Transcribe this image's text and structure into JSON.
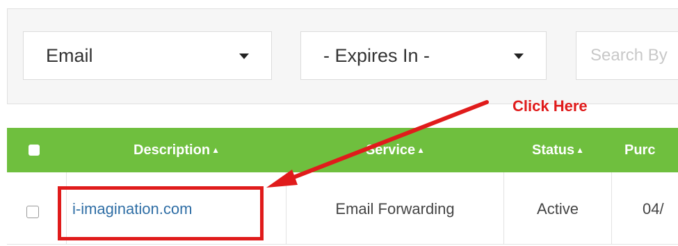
{
  "filters": {
    "type_select": {
      "value": "Email",
      "icon": "caret-down-icon"
    },
    "expires_select": {
      "value": "- Expires In -",
      "icon": "caret-down-icon"
    },
    "search": {
      "placeholder": "Search By"
    }
  },
  "table": {
    "header_color": "#6fbf3e",
    "columns": [
      {
        "label": "Description",
        "sort": "▲"
      },
      {
        "label": "Service",
        "sort": "▲"
      },
      {
        "label": "Status",
        "sort": "▲"
      },
      {
        "label": "Purc"
      }
    ],
    "rows": [
      {
        "description": "i-imagination.com",
        "service": "Email Forwarding",
        "status": "Active",
        "purchase": "04/"
      }
    ]
  },
  "annotation": {
    "label": "Click Here",
    "color": "#e01b1b"
  }
}
